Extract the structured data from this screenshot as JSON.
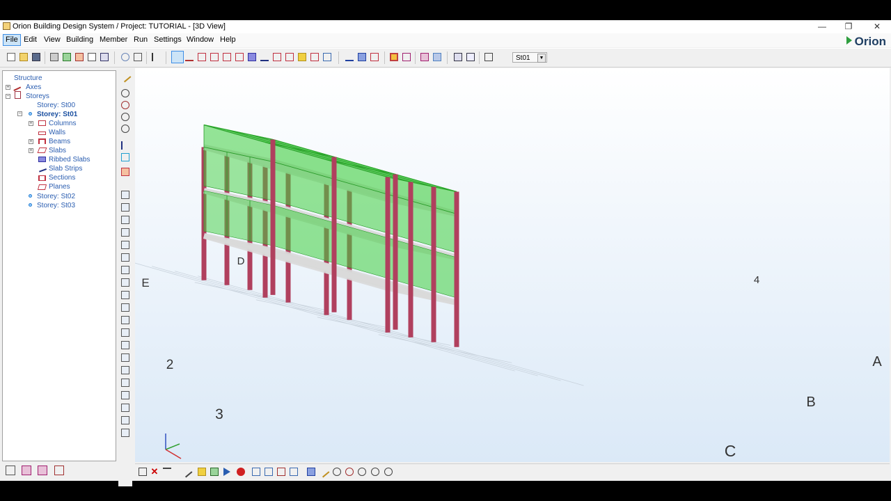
{
  "window": {
    "title": "Orion Building Design System / Project: TUTORIAL - [3D View]",
    "controls": {
      "minimize": "—",
      "restore": "❐",
      "close": "✕"
    }
  },
  "brand": {
    "name": "Orion",
    "color": "#2e9e3e"
  },
  "menu": [
    "File",
    "Edit",
    "View",
    "Building",
    "Member",
    "Run",
    "Settings",
    "Window",
    "Help"
  ],
  "toolbar": {
    "storey_selector": {
      "value": "St01"
    }
  },
  "tree": {
    "root": "Structure",
    "axes": "Axes",
    "storeys": "Storeys",
    "storey_st00": "Storey: St00",
    "storey_st01": "Storey: St01",
    "children": [
      "Columns",
      "Walls",
      "Beams",
      "Slabs",
      "Ribbed Slabs",
      "Slab Strips",
      "Sections",
      "Planes"
    ],
    "storey_st02": "Storey: St02",
    "storey_st03": "Storey: St03"
  },
  "view3d": {
    "axis_labels": [
      "D",
      "E",
      "4",
      "2",
      "3",
      "4",
      "A",
      "B",
      "C"
    ],
    "colors": {
      "slab": "#3fcf3f",
      "column": "#b0405e",
      "beam": "#d9d9d9",
      "background_top": "#ffffff",
      "background_bottom": "#dbe9f7"
    }
  }
}
